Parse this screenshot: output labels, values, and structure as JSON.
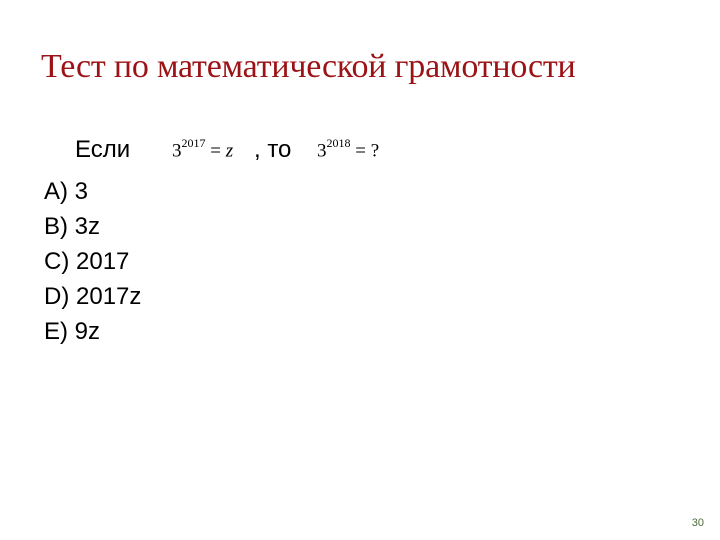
{
  "slide": {
    "title": "Тест по математической грамотности",
    "question": {
      "if_word": "Если",
      "then_word": ", то",
      "given": {
        "base": "3",
        "exponent": "2017",
        "relation": "= ",
        "variable": "z"
      },
      "asked": {
        "base": "3",
        "exponent": "2018",
        "relation": "= ?"
      }
    },
    "options": [
      {
        "label": "A)",
        "value": "3"
      },
      {
        "label": "B)",
        "value": "3z"
      },
      {
        "label": "C)",
        "value": "2017"
      },
      {
        "label": "D)",
        "value": "2017z"
      },
      {
        "label": "E)",
        "value": "9z"
      }
    ],
    "page_number": "30",
    "colors": {
      "title": "#9b1316",
      "text": "#000000",
      "page_number": "#4a6a3a"
    }
  }
}
